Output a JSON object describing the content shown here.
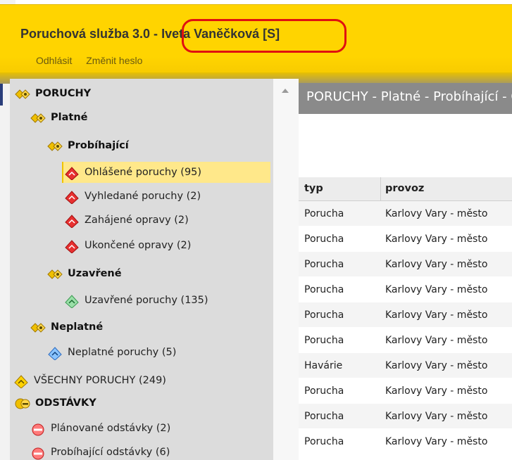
{
  "header": {
    "app_title": "Poruchová služba 3.0 - ",
    "user": "Iveta Vaněčková [S]",
    "links": {
      "logout": "Odhlásit",
      "change_password": "Změnit heslo"
    }
  },
  "sidebar": {
    "porchy": "PORUCHY",
    "platne": "Platné",
    "probihajici": "Probíhající",
    "ohlasene": "Ohlášené poruchy (95)",
    "vyhledane": "Vyhledané poruchy (2)",
    "zahajene": "Zahájené opravy (2)",
    "ukoncene": "Ukončené opravy (2)",
    "uzavrene": "Uzavřené",
    "uzavrene_poruchy": "Uzavřené poruchy (135)",
    "neplatne": "Neplatné",
    "neplatne_poruchy": "Neplatné poruchy (5)",
    "vsechny": "VŠECHNY PORUCHY (249)",
    "odstavky": "ODSTÁVKY",
    "planovane": "Plánované odstávky (2)",
    "probihajici_odstavky": "Probíhající odstávky (6)"
  },
  "content": {
    "title": "PORUCHY - Platné - Probíhající - Ohlášené poruchy",
    "columns": {
      "typ": "typ",
      "provoz": "provoz"
    },
    "rows": [
      {
        "typ": "Porucha",
        "provoz": "Karlovy Vary - město"
      },
      {
        "typ": "Porucha",
        "provoz": "Karlovy Vary - město"
      },
      {
        "typ": "Porucha",
        "provoz": "Karlovy Vary - město"
      },
      {
        "typ": "Porucha",
        "provoz": "Karlovy Vary - město"
      },
      {
        "typ": "Porucha",
        "provoz": "Karlovy Vary - město"
      },
      {
        "typ": "Porucha",
        "provoz": "Karlovy Vary - město"
      },
      {
        "typ": "Havárie",
        "provoz": "Karlovy Vary - město"
      },
      {
        "typ": "Porucha",
        "provoz": "Karlovy Vary - město"
      },
      {
        "typ": "Porucha",
        "provoz": "Karlovy Vary - město"
      },
      {
        "typ": "Porucha",
        "provoz": "Karlovy Vary - město"
      }
    ]
  },
  "colors": {
    "header_yellow": "#ffd400",
    "highlight_red": "#e01010",
    "selected_bg": "#ffe88a",
    "title_bar": "#8a8a8a"
  },
  "icons": {
    "group": "gear-diamond-icon",
    "fault_active": "red-diamond-icon",
    "fault_closed": "green-diamond-icon",
    "fault_invalid": "blue-diamond-icon",
    "outage": "no-entry-icon"
  }
}
